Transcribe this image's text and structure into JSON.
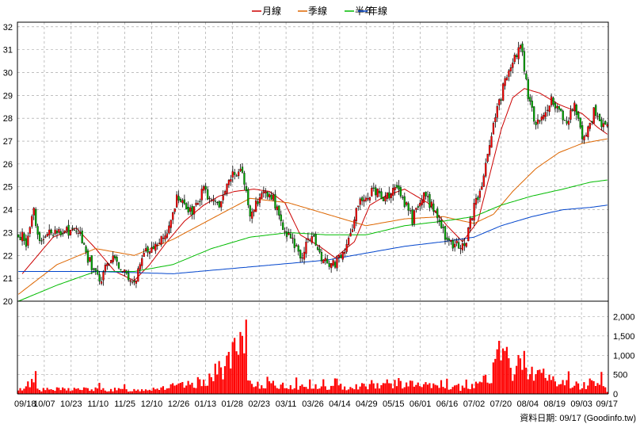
{
  "chart_data": {
    "type": "candlestick",
    "legend": [
      {
        "label": "月線",
        "color": "#cc0000"
      },
      {
        "label": "季線",
        "color": "#dd6600"
      },
      {
        "label": "半年",
        "color": "#00bb00"
      },
      {
        "label": "年線",
        "color": "#0044cc"
      }
    ],
    "price_axis": {
      "ylim": [
        20,
        32.2
      ],
      "ticks": [
        20,
        21,
        22,
        23,
        24,
        25,
        26,
        27,
        28,
        29,
        30,
        31,
        32
      ]
    },
    "volume_axis": {
      "ylim": [
        0,
        2400
      ],
      "ticks": [
        0,
        500,
        1000,
        1500,
        2000
      ],
      "tick_labels": [
        "0",
        "500",
        "1,000",
        "1,500",
        "2,000"
      ]
    },
    "x_tick_labels": [
      "09/18",
      "10/07",
      "10/23",
      "11/10",
      "11/25",
      "12/10",
      "12/26",
      "01/13",
      "01/28",
      "02/23",
      "03/11",
      "03/26",
      "04/14",
      "04/29",
      "05/15",
      "06/01",
      "06/16",
      "07/02",
      "07/20",
      "08/04",
      "08/19",
      "09/03",
      "09/17"
    ],
    "footer": "資料日期: 09/17 (Goodinfo.tw)",
    "colors": {
      "up": "#ff0000",
      "down": "#00aa00",
      "wick": "#000000",
      "volume": "#ff0000",
      "grid": "#999999"
    },
    "price_keypoints": [
      [
        0,
        23.0
      ],
      [
        4,
        22.6
      ],
      [
        8,
        24.1
      ],
      [
        10,
        22.7
      ],
      [
        20,
        23.1
      ],
      [
        26,
        23.0
      ],
      [
        32,
        22.9
      ],
      [
        35,
        22.1
      ],
      [
        42,
        20.8
      ],
      [
        48,
        22.0
      ],
      [
        55,
        21.2
      ],
      [
        60,
        20.9
      ],
      [
        66,
        22.1
      ],
      [
        72,
        22.4
      ],
      [
        78,
        23.2
      ],
      [
        82,
        24.5
      ],
      [
        90,
        23.8
      ],
      [
        96,
        24.9
      ],
      [
        104,
        24.0
      ],
      [
        110,
        25.4
      ],
      [
        116,
        25.8
      ],
      [
        120,
        23.6
      ],
      [
        126,
        24.9
      ],
      [
        132,
        24.5
      ],
      [
        136,
        23.4
      ],
      [
        142,
        22.6
      ],
      [
        146,
        21.9
      ],
      [
        152,
        22.9
      ],
      [
        158,
        21.7
      ],
      [
        164,
        21.7
      ],
      [
        168,
        22.1
      ],
      [
        172,
        22.9
      ],
      [
        176,
        24.2
      ],
      [
        184,
        24.8
      ],
      [
        190,
        24.5
      ],
      [
        196,
        25.0
      ],
      [
        204,
        23.6
      ],
      [
        210,
        24.8
      ],
      [
        216,
        23.8
      ],
      [
        222,
        22.6
      ],
      [
        228,
        22.4
      ],
      [
        232,
        22.7
      ],
      [
        236,
        24.1
      ],
      [
        240,
        25.2
      ],
      [
        244,
        26.8
      ],
      [
        248,
        28.4
      ],
      [
        252,
        29.6
      ],
      [
        256,
        30.3
      ],
      [
        260,
        31.4
      ],
      [
        264,
        29.0
      ],
      [
        268,
        27.7
      ],
      [
        272,
        28.2
      ],
      [
        276,
        28.8
      ],
      [
        280,
        28.4
      ],
      [
        284,
        27.8
      ],
      [
        288,
        28.7
      ],
      [
        292,
        27.2
      ],
      [
        296,
        27.6
      ],
      [
        298,
        28.5
      ],
      [
        302,
        27.5
      ],
      [
        305,
        27.8
      ]
    ],
    "ma_keypoints": {
      "月線": [
        [
          2,
          21.2
        ],
        [
          10,
          22.0
        ],
        [
          18,
          22.8
        ],
        [
          30,
          23.2
        ],
        [
          40,
          22.3
        ],
        [
          50,
          21.3
        ],
        [
          60,
          20.9
        ],
        [
          68,
          21.6
        ],
        [
          76,
          22.5
        ],
        [
          86,
          23.5
        ],
        [
          96,
          24.2
        ],
        [
          104,
          24.6
        ],
        [
          112,
          24.8
        ],
        [
          122,
          24.9
        ],
        [
          130,
          24.8
        ],
        [
          138,
          24.3
        ],
        [
          146,
          22.9
        ],
        [
          156,
          22.4
        ],
        [
          164,
          21.9
        ],
        [
          174,
          22.6
        ],
        [
          182,
          24.2
        ],
        [
          190,
          24.6
        ],
        [
          200,
          24.9
        ],
        [
          212,
          24.3
        ],
        [
          222,
          23.3
        ],
        [
          230,
          22.6
        ],
        [
          238,
          23.5
        ],
        [
          244,
          25.5
        ],
        [
          250,
          27.5
        ],
        [
          256,
          28.9
        ],
        [
          262,
          29.3
        ],
        [
          270,
          29.1
        ],
        [
          280,
          28.6
        ],
        [
          292,
          28.2
        ],
        [
          300,
          27.6
        ],
        [
          305,
          27.3
        ]
      ],
      "季線": [
        [
          0,
          20.3
        ],
        [
          20,
          21.6
        ],
        [
          40,
          22.3
        ],
        [
          60,
          22.0
        ],
        [
          80,
          22.7
        ],
        [
          100,
          23.6
        ],
        [
          120,
          24.5
        ],
        [
          140,
          24.3
        ],
        [
          160,
          23.8
        ],
        [
          180,
          23.3
        ],
        [
          200,
          23.6
        ],
        [
          220,
          23.7
        ],
        [
          236,
          23.4
        ],
        [
          246,
          23.8
        ],
        [
          256,
          24.8
        ],
        [
          268,
          25.8
        ],
        [
          280,
          26.5
        ],
        [
          292,
          26.9
        ],
        [
          305,
          27.1
        ]
      ],
      "半年": [
        [
          0,
          20.0
        ],
        [
          20,
          20.7
        ],
        [
          40,
          21.3
        ],
        [
          60,
          21.3
        ],
        [
          80,
          21.6
        ],
        [
          100,
          22.3
        ],
        [
          120,
          22.8
        ],
        [
          140,
          23.0
        ],
        [
          160,
          22.9
        ],
        [
          180,
          22.9
        ],
        [
          200,
          23.3
        ],
        [
          220,
          23.5
        ],
        [
          236,
          23.7
        ],
        [
          250,
          24.2
        ],
        [
          266,
          24.6
        ],
        [
          282,
          24.9
        ],
        [
          296,
          25.2
        ],
        [
          305,
          25.3
        ]
      ],
      "年線": [
        [
          0,
          21.3
        ],
        [
          40,
          21.3
        ],
        [
          80,
          21.2
        ],
        [
          120,
          21.5
        ],
        [
          160,
          21.8
        ],
        [
          180,
          22.1
        ],
        [
          200,
          22.4
        ],
        [
          220,
          22.6
        ],
        [
          236,
          22.8
        ],
        [
          250,
          23.3
        ],
        [
          266,
          23.7
        ],
        [
          282,
          24.0
        ],
        [
          296,
          24.1
        ],
        [
          305,
          24.2
        ]
      ]
    },
    "volume_keypoints": [
      [
        0,
        80
      ],
      [
        8,
        400
      ],
      [
        12,
        120
      ],
      [
        30,
        140
      ],
      [
        60,
        110
      ],
      [
        90,
        260
      ],
      [
        100,
        480
      ],
      [
        116,
        1300
      ],
      [
        120,
        300
      ],
      [
        140,
        220
      ],
      [
        160,
        180
      ],
      [
        178,
        230
      ],
      [
        196,
        310
      ],
      [
        216,
        210
      ],
      [
        234,
        150
      ],
      [
        246,
        650
      ],
      [
        250,
        1150
      ],
      [
        256,
        680
      ],
      [
        262,
        920
      ],
      [
        270,
        560
      ],
      [
        280,
        330
      ],
      [
        292,
        220
      ],
      [
        302,
        480
      ],
      [
        305,
        60
      ]
    ]
  }
}
